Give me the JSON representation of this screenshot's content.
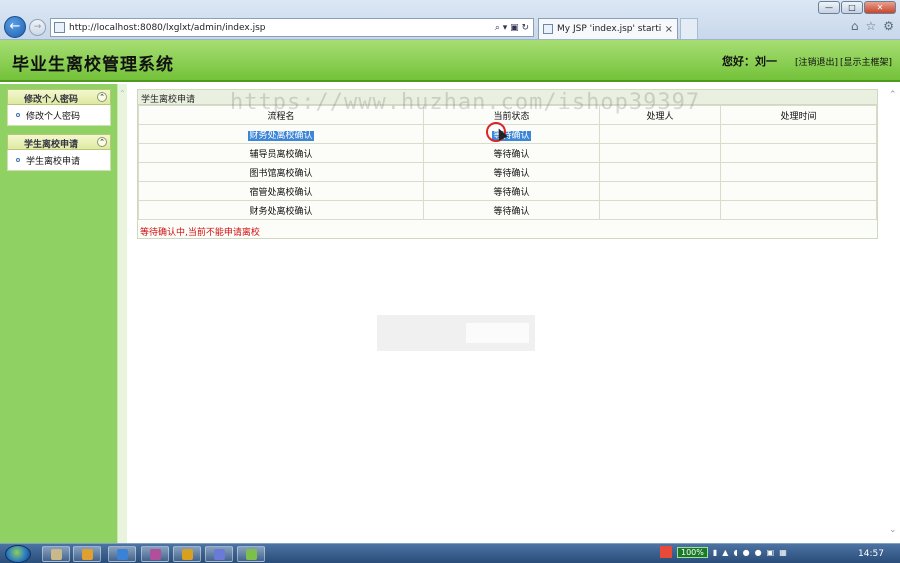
{
  "browser": {
    "window_buttons": [
      "—",
      "□",
      "✕"
    ],
    "back_glyph": "←",
    "forward_glyph": "→",
    "address_url": "http://localhost:8080/lxglxt/admin/index.jsp",
    "address_tools": "⌕ ▾ ▣ ↻",
    "tab_label": "My JSP 'index.jsp' startin...",
    "tab_close": "×",
    "toolbar_icons": [
      "⌂",
      "☆",
      "⚙"
    ]
  },
  "header": {
    "system_title": "毕业生离校管理系统",
    "greeting": "您好：刘一",
    "logout_link": "[注销退出]",
    "show_frame_link": "[显示主框架]"
  },
  "sidebar": {
    "toggle_glyph": "⌃",
    "groups": [
      {
        "title": "修改个人密码",
        "items": [
          {
            "label": "修改个人密码"
          }
        ]
      },
      {
        "title": "学生离校申请",
        "items": [
          {
            "label": "学生离校申请"
          }
        ]
      }
    ]
  },
  "content": {
    "panel_title": "学生离校申请",
    "watermark": "https://www.huzhan.com/ishop39397",
    "columns": [
      "流程名",
      "当前状态",
      "处理人",
      "处理时间"
    ],
    "rows": [
      {
        "process": "财务处离校确认",
        "status": "等待确认",
        "handler": "",
        "time": ""
      },
      {
        "process": "辅导员离校确认",
        "status": "等待确认",
        "handler": "",
        "time": ""
      },
      {
        "process": "图书馆离校确认",
        "status": "等待确认",
        "handler": "",
        "time": ""
      },
      {
        "process": "宿管处离校确认",
        "status": "等待确认",
        "handler": "",
        "time": ""
      },
      {
        "process": "财务处离校确认",
        "status": "等待确认",
        "handler": "",
        "time": ""
      }
    ],
    "notice": "等待确认中,当前不能申请离校"
  },
  "taskbar": {
    "battery": "100%",
    "clock": "14:57",
    "app_colors": [
      "#c9b98a",
      "#e0a030",
      "#3b82d6",
      "#b0509a",
      "#d8a020",
      "#6a7ad6",
      "#7ac04a"
    ]
  }
}
